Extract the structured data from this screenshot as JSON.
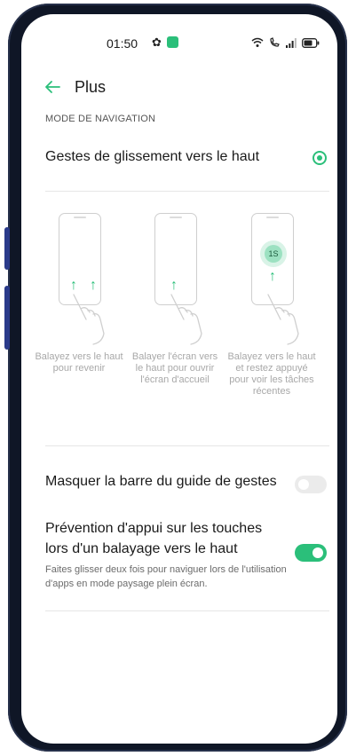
{
  "status_bar": {
    "time": "01:50"
  },
  "header": {
    "title": "Plus"
  },
  "section_label": "MODE DE NAVIGATION",
  "navigation_option": {
    "label": "Gestes de glissement vers le haut",
    "selected": true
  },
  "illustrations": [
    {
      "caption": "Balayez vers le haut pour revenir"
    },
    {
      "caption": "Balayer l'écran vers le haut pour ouvrir l'écran d'accueil"
    },
    {
      "caption": "Balayez vers le haut et restez appuyé pour voir les tâches récentes",
      "hold_badge": "1S"
    }
  ],
  "settings": {
    "hide_guide_bar": {
      "label": "Masquer la barre du guide de gestes",
      "enabled": false
    },
    "prevention": {
      "label": "Prévention d'appui sur les touches lors d'un balayage vers le haut",
      "description": "Faites glisser deux fois pour naviguer lors de l'utilisation d'apps en mode paysage plein écran.",
      "enabled": true
    }
  },
  "colors": {
    "accent": "#2bbf7a",
    "frame": "#0f1626"
  },
  "icons": [
    "gear-icon",
    "app-notification-icon",
    "wifi-icon",
    "call-icon",
    "signal-icon",
    "battery-icon",
    "back-arrow-icon",
    "hand-gesture-icon"
  ]
}
